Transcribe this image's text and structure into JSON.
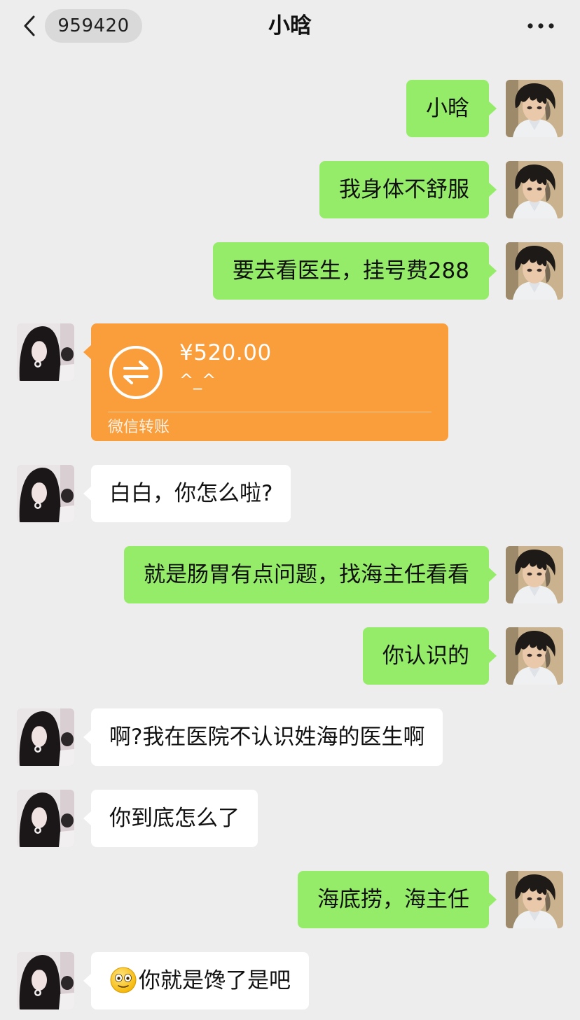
{
  "header": {
    "unread_count": "959420",
    "title": "小晗"
  },
  "messages": [
    {
      "text": "小晗"
    },
    {
      "text": "我身体不舒服"
    },
    {
      "text": "要去看医生，挂号费288"
    },
    {
      "amount": "¥520.00",
      "note": "^_^",
      "label": "微信转账"
    },
    {
      "text": "白白，你怎么啦?"
    },
    {
      "text": "就是肠胃有点问题，找海主任看看"
    },
    {
      "text": "你认识的"
    },
    {
      "text": "啊?我在医院不认识姓海的医生啊"
    },
    {
      "text": "你到底怎么了"
    },
    {
      "text": "海底捞，海主任"
    },
    {
      "emoji": "smiley-emoji",
      "text": "你就是馋了是吧"
    }
  ],
  "colors": {
    "background": "#ededed",
    "sent_bubble": "#95ec69",
    "received_bubble": "#ffffff",
    "transfer_card": "#fa9d3b"
  },
  "icons": [
    "back-chevron-icon",
    "more-dots-icon",
    "transfer-arrows-icon",
    "smiley-emoji"
  ]
}
